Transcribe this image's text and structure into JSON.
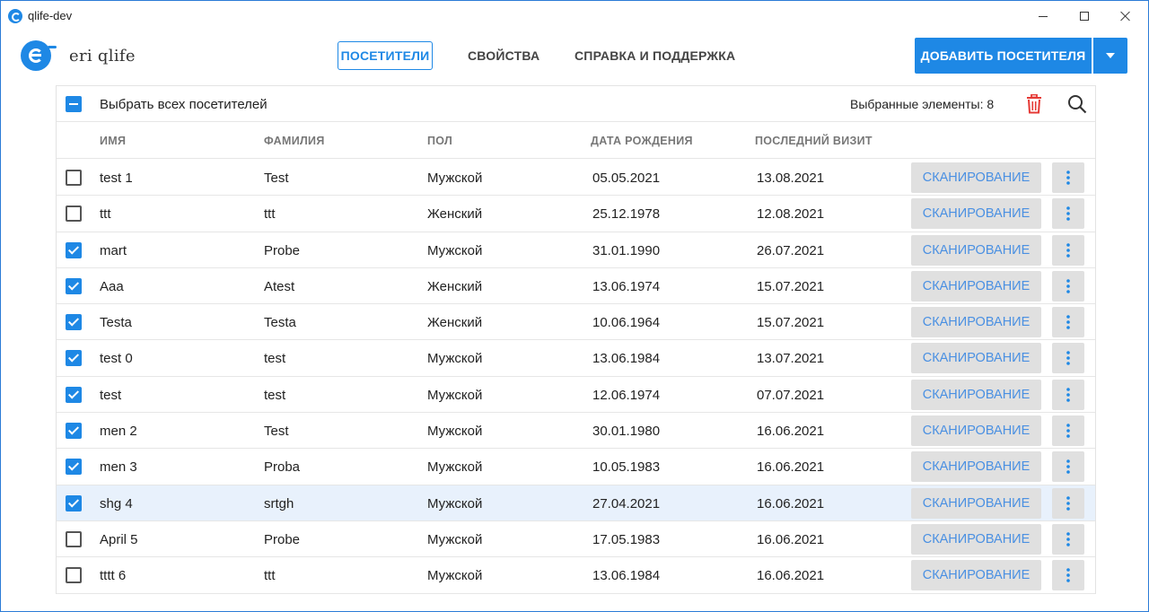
{
  "window": {
    "title": "qlife-dev"
  },
  "app": {
    "brand": "eri qlife"
  },
  "nav": {
    "visitors": "ПОСЕТИТЕЛИ",
    "properties": "СВОЙСТВА",
    "help": "СПРАВКА И ПОДДЕРЖКА"
  },
  "actions": {
    "add_visitor": "ДОБАВИТЬ ПОСЕТИТЕЛЯ"
  },
  "toolbar": {
    "select_all": "Выбрать всех посетителей",
    "selected_count": "Выбранные элементы: 8"
  },
  "table": {
    "columns": [
      "ИМЯ",
      "ФАМИЛИЯ",
      "ПОЛ",
      "ДАТА РОЖДЕНИЯ",
      "ПОСЛЕДНИЙ ВИЗИТ"
    ],
    "scan_label": "СКАНИРОВАНИЕ",
    "rows": [
      {
        "checked": false,
        "name": "test 1",
        "surname": "Test",
        "sex": "Мужской",
        "birth": "05.05.2021",
        "last_visit": "13.08.2021"
      },
      {
        "checked": false,
        "name": "ttt",
        "surname": "ttt",
        "sex": "Женский",
        "birth": "25.12.1978",
        "last_visit": "12.08.2021"
      },
      {
        "checked": true,
        "name": "mart",
        "surname": "Probe",
        "sex": "Мужской",
        "birth": "31.01.1990",
        "last_visit": "26.07.2021"
      },
      {
        "checked": true,
        "name": "Aaa",
        "surname": "Atest",
        "sex": "Женский",
        "birth": "13.06.1974",
        "last_visit": "15.07.2021"
      },
      {
        "checked": true,
        "name": "Testa",
        "surname": "Testa",
        "sex": "Женский",
        "birth": "10.06.1964",
        "last_visit": "15.07.2021"
      },
      {
        "checked": true,
        "name": "test 0",
        "surname": "test",
        "sex": "Мужской",
        "birth": "13.06.1984",
        "last_visit": "13.07.2021"
      },
      {
        "checked": true,
        "name": "test",
        "surname": "test",
        "sex": "Мужской",
        "birth": "12.06.1974",
        "last_visit": "07.07.2021"
      },
      {
        "checked": true,
        "name": "men 2",
        "surname": "Test",
        "sex": "Мужской",
        "birth": "30.01.1980",
        "last_visit": "16.06.2021"
      },
      {
        "checked": true,
        "name": "men 3",
        "surname": "Proba",
        "sex": "Мужской",
        "birth": "10.05.1983",
        "last_visit": "16.06.2021"
      },
      {
        "checked": true,
        "name": "shg 4",
        "surname": "srtgh",
        "sex": "Мужской",
        "birth": "27.04.2021",
        "last_visit": "16.06.2021",
        "highlight": true
      },
      {
        "checked": false,
        "name": "April 5",
        "surname": "Probe",
        "sex": "Мужской",
        "birth": "17.05.1983",
        "last_visit": "16.06.2021"
      },
      {
        "checked": false,
        "name": "tttt 6",
        "surname": "ttt",
        "sex": "Мужской",
        "birth": "13.06.1984",
        "last_visit": "16.06.2021"
      }
    ]
  },
  "colors": {
    "accent": "#1e88e5",
    "delete": "#e53935",
    "scan_text": "#4a90e2",
    "row_highlight": "#e8f1fc"
  },
  "icons": {
    "app": "app-logo-icon",
    "minimize": "minimize-icon",
    "maximize": "maximize-icon",
    "close": "close-icon",
    "dropdown": "chevron-down-icon",
    "delete": "trash-icon",
    "search": "search-icon",
    "more": "more-vertical-icon"
  }
}
